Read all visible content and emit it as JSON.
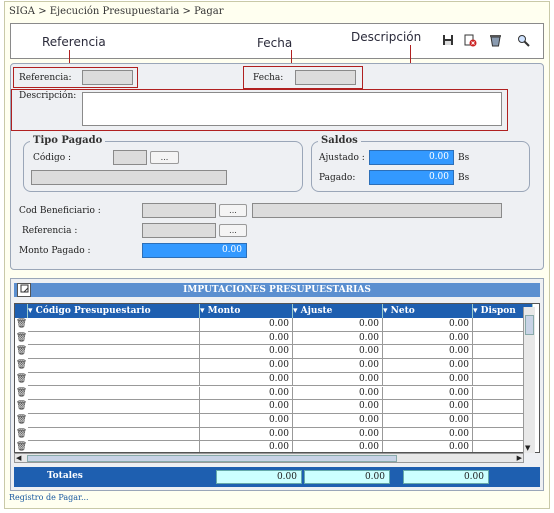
{
  "breadcrumb": "SIGA > Ejecución Presupuestaria > Pagar",
  "annotations": {
    "referencia": "Referencia",
    "fecha": "Fecha",
    "descripcion": "Descripción"
  },
  "toolbar": {
    "icons": [
      "save-icon",
      "delete-icon",
      "clear-icon",
      "search-icon"
    ]
  },
  "form": {
    "referencia_label": "Referencia:",
    "fecha_label": "Fecha:",
    "descripcion_label": "Descripción:",
    "tipo_pagado_legend": "Tipo Pagado",
    "codigo_label": "Código :",
    "saldos_legend": "Saldos",
    "ajustado_label": "Ajustado :",
    "ajustado_value": "0.00",
    "ajustado_unit": "Bs",
    "pagado_label": "Pagado:",
    "pagado_value": "0.00",
    "pagado_unit": "Bs",
    "cod_beneficiario_label": "Cod Beneficiario :",
    "referencia2_label": "Referencia :",
    "monto_pagado_label": "Monto Pagado :",
    "monto_pagado_value": "0.00",
    "dots": "..."
  },
  "grid": {
    "title": "IMPUTACIONES PRESUPUESTARIAS",
    "columns": [
      "Código Presupuestario",
      "Monto",
      "Ajuste",
      "Neto",
      "Dispon"
    ],
    "rows": [
      [
        "",
        "0.00",
        "0.00",
        "0.00",
        ""
      ],
      [
        "",
        "0.00",
        "0.00",
        "0.00",
        ""
      ],
      [
        "",
        "0.00",
        "0.00",
        "0.00",
        ""
      ],
      [
        "",
        "0.00",
        "0.00",
        "0.00",
        ""
      ],
      [
        "",
        "0.00",
        "0.00",
        "0.00",
        ""
      ],
      [
        "",
        "0.00",
        "0.00",
        "0.00",
        ""
      ],
      [
        "",
        "0.00",
        "0.00",
        "0.00",
        ""
      ],
      [
        "",
        "0.00",
        "0.00",
        "0.00",
        ""
      ],
      [
        "",
        "0.00",
        "0.00",
        "0.00",
        ""
      ],
      [
        "",
        "0.00",
        "0.00",
        "0.00",
        ""
      ]
    ],
    "totals_label": "Totales",
    "totals": [
      "0.00",
      "0.00",
      "0.00"
    ]
  },
  "status": "Registro de Pagar..."
}
